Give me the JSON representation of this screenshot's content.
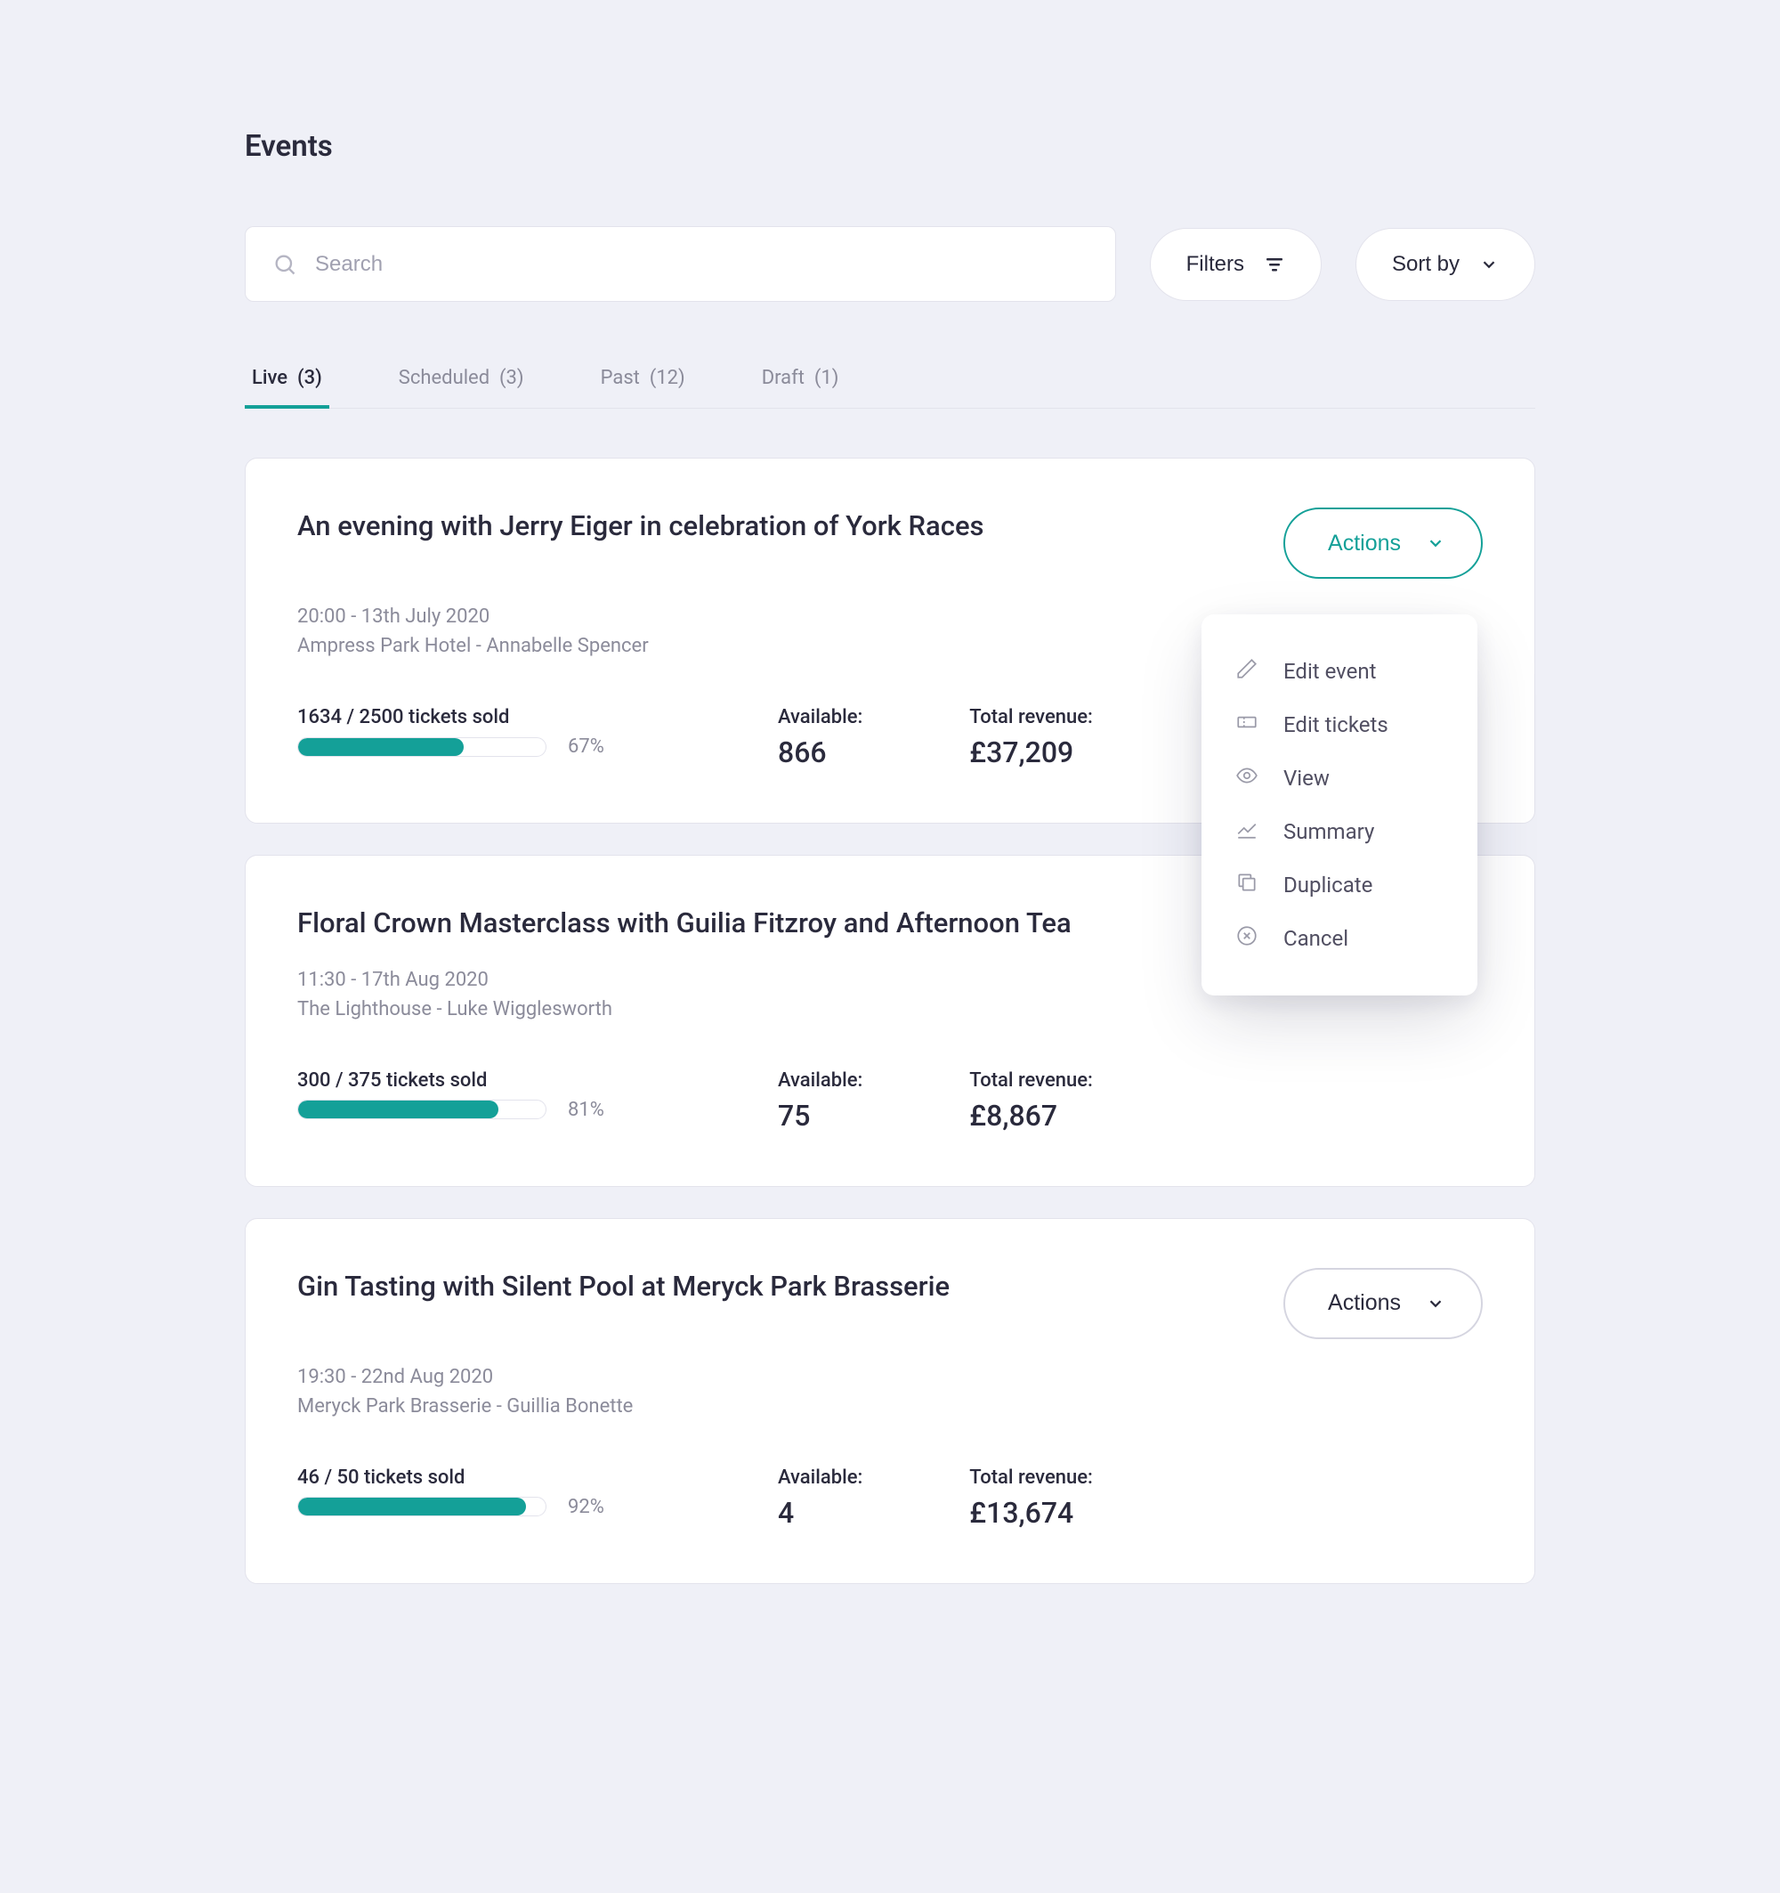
{
  "page_title": "Events",
  "search": {
    "placeholder": "Search"
  },
  "filters_button": "Filters",
  "sort_button": "Sort by",
  "tabs": [
    {
      "label": "Live",
      "count": 3,
      "active": true
    },
    {
      "label": "Scheduled",
      "count": 3,
      "active": false
    },
    {
      "label": "Past",
      "count": 12,
      "active": false
    },
    {
      "label": "Draft",
      "count": 1,
      "active": false
    }
  ],
  "actions_label": "Actions",
  "labels": {
    "available": "Available:",
    "total_revenue": "Total revenue:"
  },
  "actions_menu": [
    {
      "icon": "pencil",
      "label": "Edit event"
    },
    {
      "icon": "ticket",
      "label": "Edit tickets"
    },
    {
      "icon": "eye",
      "label": "View"
    },
    {
      "icon": "chart",
      "label": "Summary"
    },
    {
      "icon": "duplicate",
      "label": "Duplicate"
    },
    {
      "icon": "cancel",
      "label": "Cancel"
    }
  ],
  "events": [
    {
      "title": "An evening with Jerry Eiger in celebration of York Races",
      "datetime": "20:00 - 13th July 2020",
      "venue_host": "Ampress Park Hotel - Annabelle Spencer",
      "sold": 1634,
      "capacity": 2500,
      "sold_text": "1634 / 2500 tickets sold",
      "percent": 67,
      "percent_text": "67%",
      "available": 866,
      "revenue": "£37,209",
      "menu_open": true
    },
    {
      "title": "Floral Crown Masterclass with Guilia Fitzroy and Afternoon Tea",
      "datetime": "11:30 - 17th Aug 2020",
      "venue_host": "The Lighthouse - Luke Wigglesworth",
      "sold": 300,
      "capacity": 375,
      "sold_text": "300 / 375 tickets sold",
      "percent": 81,
      "percent_text": "81%",
      "available": 75,
      "revenue": "£8,867",
      "menu_open": false,
      "hide_actions": true
    },
    {
      "title": "Gin Tasting with Silent Pool at Meryck Park Brasserie",
      "datetime": "19:30 - 22nd Aug 2020",
      "venue_host": "Meryck Park Brasserie - Guillia Bonette",
      "sold": 46,
      "capacity": 50,
      "sold_text": "46 / 50 tickets sold",
      "percent": 92,
      "percent_text": "92%",
      "available": 4,
      "revenue": "£13,674",
      "menu_open": false
    }
  ]
}
